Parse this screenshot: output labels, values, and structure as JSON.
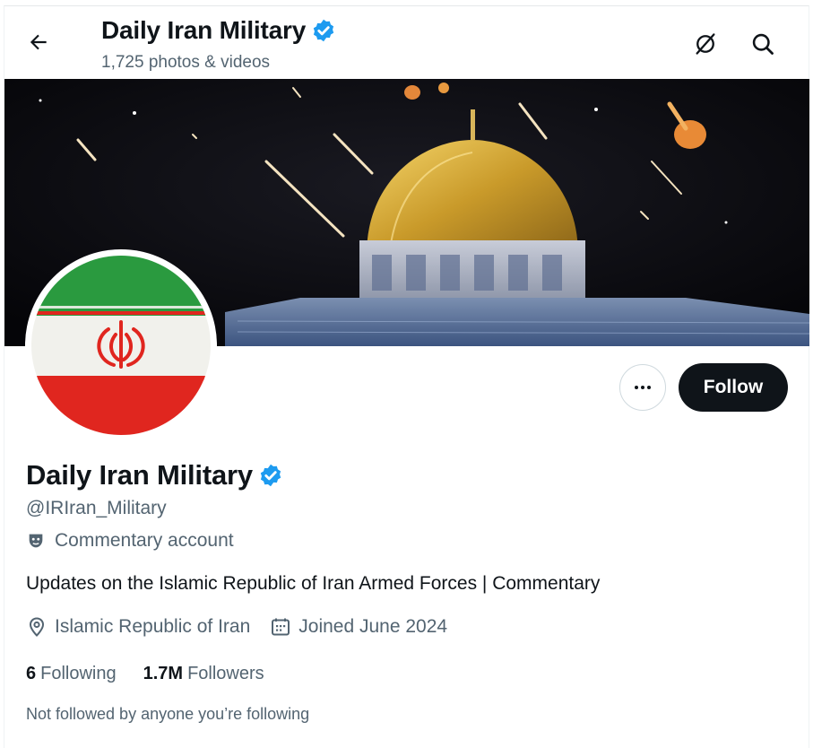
{
  "header": {
    "title": "Daily Iran Military",
    "subtitle": "1,725 photos & videos",
    "back_icon": "arrow-left-icon",
    "grok_icon": "grok-icon",
    "search_icon": "search-icon"
  },
  "profile": {
    "name": "Daily Iran Military",
    "handle": "@IRIran_Military",
    "label": "Commentary account",
    "bio": "Updates on the Islamic Republic of Iran Armed Forces | Commentary",
    "location": "Islamic Republic of Iran",
    "joined": "Joined June 2024",
    "following_count": "6",
    "following_label": "Following",
    "followers_count": "1.7M",
    "followers_label": "Followers",
    "not_followed": "Not followed by anyone you’re following"
  },
  "actions": {
    "more_icon": "more-dots-icon",
    "follow_label": "Follow"
  },
  "colors": {
    "verified": "#1d9bf0",
    "follow_bg": "#0f1419",
    "secondary_text": "#536471"
  }
}
